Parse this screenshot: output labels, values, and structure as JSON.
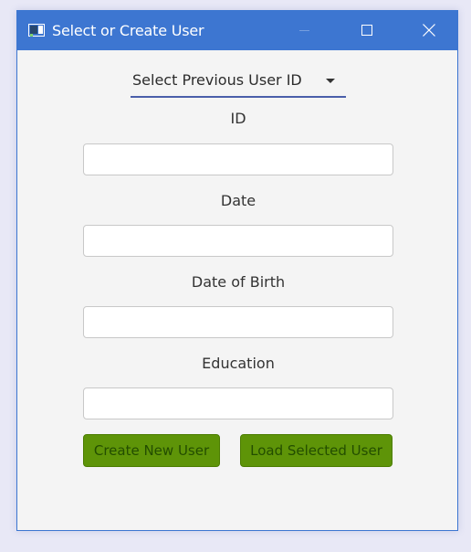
{
  "window": {
    "title": "Select or Create User"
  },
  "user_select": {
    "label": "Select Previous User ID"
  },
  "form": {
    "fields": [
      {
        "label": "ID",
        "value": ""
      },
      {
        "label": "Date",
        "value": ""
      },
      {
        "label": "Date of Birth",
        "value": ""
      },
      {
        "label": "Education",
        "value": ""
      }
    ]
  },
  "actions": {
    "create_label": "Create New User",
    "load_label": "Load Selected User"
  },
  "colors": {
    "titlebar": "#3d76d1",
    "button_green": "#5e9408",
    "button_text": "#234d00",
    "combo_underline": "#4a5faa"
  },
  "icons": {
    "app": "window-app-icon",
    "minimize": "minimize-icon",
    "maximize": "maximize-icon",
    "close": "close-icon",
    "dropdown": "caret-down-icon"
  }
}
